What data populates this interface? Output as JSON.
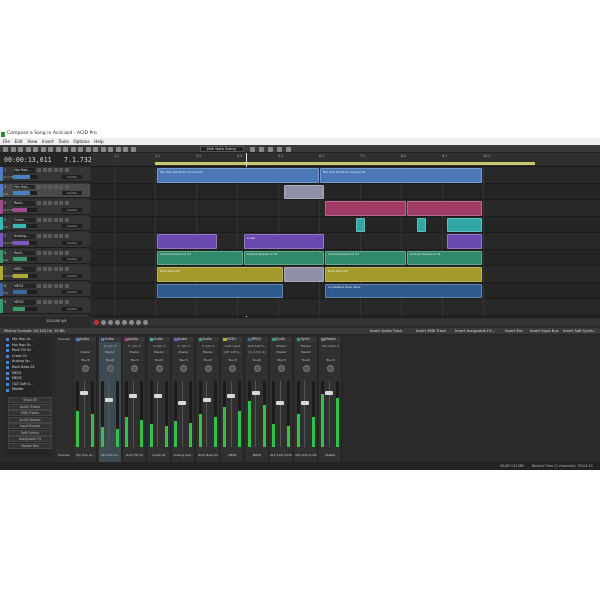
{
  "window": {
    "title": "Compose a Song in Acid.acd - ACID Pro"
  },
  "menu": [
    "File",
    "Edit",
    "View",
    "Insert",
    "Tools",
    "Options",
    "Help"
  ],
  "toolbar": {
    "swing": "16th Note Swing"
  },
  "time": {
    "position": "00:00:13,611",
    "beat": "7.1.732"
  },
  "ruler": [
    "1.1",
    "2.1",
    "3.1",
    "4.1",
    "5.1",
    "6.1",
    "7.1",
    "8.1",
    "9.1",
    "10.1"
  ],
  "tracks": [
    {
      "num": "1",
      "name": "Hip Hop...",
      "color": "#4a7fc0",
      "vol_label": "-6.2 dB",
      "pan": "Center",
      "vol": 0.72
    },
    {
      "num": "2",
      "name": "Hip Hop...",
      "color": "#4a7fc0",
      "vol_label": "Out",
      "pan": "Center",
      "vol": 0.7,
      "selected": true
    },
    {
      "num": "3",
      "name": "Rock...",
      "color": "#a04a8f",
      "vol_label": "-8.2 dB",
      "pan": "Center",
      "vol": 0.6
    },
    {
      "num": "4",
      "name": "Crash...",
      "color": "#3cb6b0",
      "vol_label": "Out",
      "pan": "Center",
      "vol": 0.55
    },
    {
      "num": "5",
      "name": "Analog...",
      "color": "#7a5ac0",
      "vol_label": "-6.2 dB",
      "pan": "Center",
      "vol": 0.65
    },
    {
      "num": "6",
      "name": "Rock...",
      "color": "#3a9a70",
      "vol_label": "Out",
      "pan": "Center",
      "vol": 0.6
    },
    {
      "num": "7",
      "name": "MIDI...",
      "color": "#b0a838",
      "vol_label": "-6.2 dB",
      "pan": "Center",
      "vol": 0.62
    },
    {
      "num": "8",
      "name": "MED1",
      "color": "#3a6aa0",
      "vol_label": "Out",
      "pan": "Center",
      "vol": 0.58
    },
    {
      "num": "9",
      "name": "MED2",
      "color": "#3a9a6a",
      "vol_label": "",
      "pan": "Center",
      "vol": 0.5
    }
  ],
  "clips": [
    {
      "track": 0,
      "start": 0.13,
      "end": 0.45,
      "color": "#4b78b8",
      "label": "Hip Hop Kit Drum Groove 01"
    },
    {
      "track": 0,
      "start": 0.45,
      "end": 0.77,
      "color": "#4b78b8",
      "label": "Hip Hop Kit Drum Groove 01"
    },
    {
      "track": 1,
      "start": 0.38,
      "end": 0.46,
      "color": "#8f8fa8",
      "label": ""
    },
    {
      "track": 2,
      "start": 0.46,
      "end": 0.62,
      "color": "#9e3a63",
      "label": ""
    },
    {
      "track": 2,
      "start": 0.62,
      "end": 0.77,
      "color": "#9e3a63",
      "label": ""
    },
    {
      "track": 3,
      "start": 0.52,
      "end": 0.54,
      "color": "#2fa7a4",
      "label": ""
    },
    {
      "track": 3,
      "start": 0.64,
      "end": 0.66,
      "color": "#2fa7a4",
      "label": ""
    },
    {
      "track": 3,
      "start": 0.7,
      "end": 0.77,
      "color": "#2fa7a4",
      "label": ""
    },
    {
      "track": 4,
      "start": 0.13,
      "end": 0.25,
      "color": "#6a4ab0",
      "label": ""
    },
    {
      "track": 4,
      "start": 0.3,
      "end": 0.46,
      "color": "#6a4ab0",
      "label": "Crash"
    },
    {
      "track": 4,
      "start": 0.7,
      "end": 0.77,
      "color": "#6a4ab0",
      "label": ""
    },
    {
      "track": 5,
      "start": 0.13,
      "end": 0.3,
      "color": "#2e8a68",
      "label": "Analog Sequence 01"
    },
    {
      "track": 5,
      "start": 0.3,
      "end": 0.46,
      "color": "#2e8a68",
      "label": "Analog Sequence 01"
    },
    {
      "track": 5,
      "start": 0.46,
      "end": 0.62,
      "color": "#2e8a68",
      "label": "Analog Sequence 01"
    },
    {
      "track": 5,
      "start": 0.62,
      "end": 0.77,
      "color": "#2e8a68",
      "label": "Analog Sequence 01"
    },
    {
      "track": 6,
      "start": 0.38,
      "end": 0.46,
      "color": "#8f8fa8",
      "label": ""
    },
    {
      "track": 6,
      "start": 0.13,
      "end": 0.38,
      "color": "#a49a2c",
      "label": "Rock Bass 04"
    },
    {
      "track": 6,
      "start": 0.46,
      "end": 0.77,
      "color": "#a49a2c",
      "label": "Rock Bass 04"
    },
    {
      "track": 7,
      "start": 0.13,
      "end": 0.38,
      "color": "#2e5a90",
      "label": ""
    },
    {
      "track": 7,
      "start": 0.46,
      "end": 0.77,
      "color": "#2e5a90",
      "label": "Crystalline Harp Note"
    }
  ],
  "transport": {
    "bpm": "120.000",
    "sig": "4/4"
  },
  "mixer": {
    "title": "Mixing Console: 44,100 Hz, 16 Bit",
    "actions": [
      "Insert Audio Track",
      "Insert MIDI Track",
      "Insert Assignable FX...",
      "Insert Bus",
      "Insert Input Bus",
      "Insert Soft Synth..."
    ],
    "list": [
      "Hip Hop Gr...",
      "Hip Hop Gr...",
      "Rock Fill 02",
      "Crash 01",
      "Analog Se...",
      "Rock Bass 04",
      "MED1",
      "MED2",
      "OLE Soft S...",
      "Master"
    ],
    "buttons": [
      "Show All",
      "Audio Tracks",
      "MIDI Tracks",
      "Audio Busses",
      "Input Busses",
      "Soft Synths",
      "Assignable FX",
      "Master Bus"
    ],
    "preview": "Preview",
    "strips": [
      {
        "type": "Audio",
        "io": "",
        "out": "Master",
        "touch": "Touch",
        "label": "Hip Hop Gr...",
        "color": "#4a7fc0",
        "meter": 0.55,
        "fader": 0.15
      },
      {
        "type": "Audio",
        "io": "In 1/In 2",
        "out": "Master",
        "touch": "Touch",
        "label": "Hip Hop Gr...",
        "color": "#4a7fc0",
        "meter": 0.3,
        "fader": 0.25,
        "selected": true
      },
      {
        "type": "Audio",
        "io": "In 1/In 2",
        "out": "Master",
        "touch": "Touch",
        "label": "Rock Fill 02",
        "color": "#a04a8f",
        "meter": 0.45,
        "fader": 0.2
      },
      {
        "type": "Audio",
        "io": "In 1/In 2",
        "out": "Master",
        "touch": "Touch",
        "label": "Crash 01",
        "color": "#3cb6b0",
        "meter": 0.35,
        "fader": 0.2
      },
      {
        "type": "Audio",
        "io": "In 1/In 2",
        "out": "Master",
        "touch": "Touch",
        "label": "Analog Seq...",
        "color": "#7a5ac0",
        "meter": 0.4,
        "fader": 0.3
      },
      {
        "type": "Audio",
        "io": "In 1/In 2",
        "out": "Master",
        "touch": "Touch",
        "label": "Rock Bass 04",
        "color": "#3a9a70",
        "meter": 0.5,
        "fader": 0.25
      },
      {
        "type": "MED1",
        "io": "Auto Input",
        "out": "OLE Soft S...",
        "touch": "Touch",
        "label": "MED1",
        "color": "#b0a838",
        "meter": 0.6,
        "fader": 0.2
      },
      {
        "type": "MED2",
        "io": "OLE Soft S...",
        "out": "[In 1] [In 4]",
        "touch": "Touch",
        "label": "MED2",
        "color": "#3a6aa0",
        "meter": 0.7,
        "fader": 0.15
      },
      {
        "type": "Synth",
        "io": "Master",
        "out": "Master",
        "touch": "Touch",
        "label": "OLE Soft Synth 1 [In 4]",
        "color": "#3a9a6a",
        "meter": 0.35,
        "fader": 0.3
      },
      {
        "type": "Synth",
        "io": "Master",
        "out": "Master",
        "touch": "Touch",
        "label": "OLE Soft Synth 1 [In 4]",
        "color": "#3a9a6a",
        "meter": 0.5,
        "fader": 0.3
      },
      {
        "type": "Master",
        "io": "Out 1/Out 2",
        "out": "",
        "touch": "Touch",
        "label": "Master",
        "color": "#777777",
        "meter": 0.8,
        "fader": 0.15
      }
    ]
  },
  "status": {
    "memory": "20/63 123 MB",
    "record": "Record Time (2 channels): 33:10:13"
  }
}
